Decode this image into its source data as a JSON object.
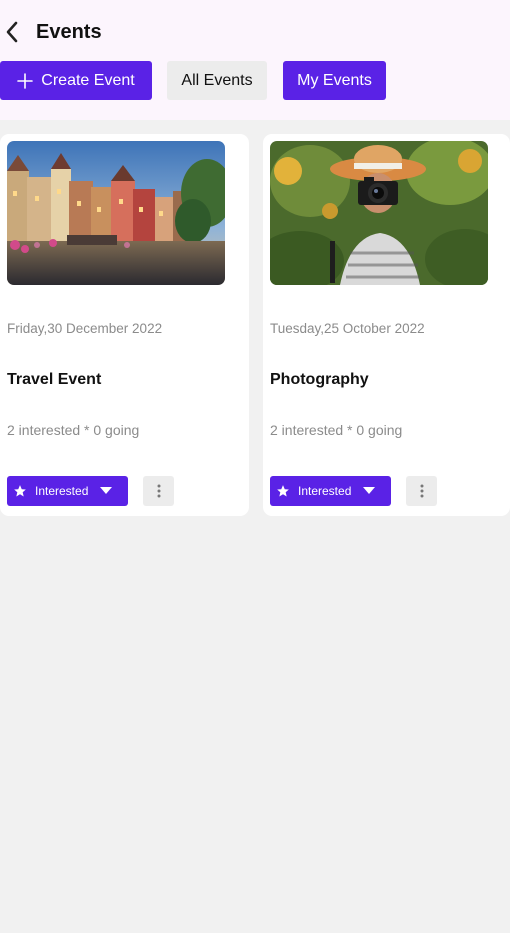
{
  "header": {
    "title": "Events",
    "back_icon": "chevron-left-icon",
    "buttons": {
      "create_label": "Create Event",
      "create_icon": "plus-icon",
      "all_label": "All Events",
      "my_label": "My Events"
    }
  },
  "colors": {
    "accent": "#5a22e6",
    "header_bg": "#fcf5fd",
    "page_bg": "#f1f1f1",
    "muted_text": "#8b8b8b"
  },
  "events": [
    {
      "image_icon": "town-canal-photo",
      "date": "Friday,30 December 2022",
      "title": "Travel Event",
      "stats": "2 interested * 0 going",
      "interested_label": "Interested",
      "more_icon": "kebab-menu-icon"
    },
    {
      "image_icon": "photographer-photo",
      "date": "Tuesday,25 October 2022",
      "title": "Photography",
      "stats": "2 interested * 0 going",
      "interested_label": "Interested",
      "more_icon": "kebab-menu-icon"
    }
  ]
}
